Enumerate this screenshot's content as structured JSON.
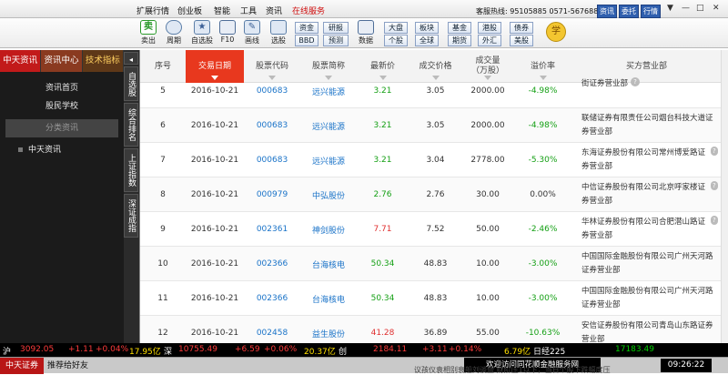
{
  "menubar": {
    "items": [
      "扩展行情",
      "创业板",
      "智能",
      "工具",
      "资讯",
      "在线服务"
    ],
    "hotline": "客服热线: 95105885  0571-56768888",
    "buttons": [
      "资讯",
      "委托",
      "行情"
    ],
    "controls": [
      "▼",
      "—",
      "□",
      "✕"
    ]
  },
  "toolbar": {
    "tools": [
      {
        "label": "卖出",
        "icon": "sell-icon",
        "color": "#2a9a2a"
      },
      {
        "label": "周期",
        "icon": "clock-icon",
        "color": "#5c7fa8"
      },
      {
        "label": "自选股",
        "icon": "star-icon",
        "color": "#5c7fa8"
      },
      {
        "label": "F10",
        "icon": "f10-icon",
        "color": "#4f6e98"
      },
      {
        "label": "画线",
        "icon": "pen-icon",
        "color": "#5c7fa8"
      },
      {
        "label": "选股",
        "icon": "filter-icon",
        "color": "#5c7fa8"
      },
      {
        "label": "数据",
        "icon": "pe-icon",
        "color": "#4f6e98"
      }
    ],
    "small_buttons": [
      "资金",
      "BBD",
      "研报",
      "预测",
      "大盘",
      "个股",
      "板块",
      "全球",
      "基金",
      "期货",
      "港股",
      "外汇",
      "债券",
      "美股"
    ],
    "learn_icon": "学"
  },
  "sidebar": {
    "tabs": [
      "中天资讯",
      "资讯中心",
      "技术指标"
    ],
    "links": [
      "资讯首页",
      "股民学校",
      "分类资讯"
    ],
    "tree": [
      "中天资讯"
    ],
    "vtabs": [
      "自选股",
      "综合排名",
      "上证指数",
      "深证成指"
    ]
  },
  "table": {
    "headers": [
      "序号",
      "交易日期",
      "股票代码",
      "股票简称",
      "最新价",
      "成交价格",
      "成交量\n（万股）",
      "溢价率",
      "买方营业部"
    ],
    "rows": [
      {
        "no": "5",
        "date": "2016-10-21",
        "code": "000683",
        "name": "远兴能源",
        "latest": "3.21",
        "latest_color": "green",
        "price": "3.05",
        "volume": "2000.00",
        "premium": "-4.98%",
        "premium_color": "green",
        "broker": "街证券营业部",
        "broker_help": true
      },
      {
        "no": "6",
        "date": "2016-10-21",
        "code": "000683",
        "name": "远兴能源",
        "latest": "3.21",
        "latest_color": "green",
        "price": "3.05",
        "volume": "2000.00",
        "premium": "-4.98%",
        "premium_color": "green",
        "broker": "联储证券有限责任公司烟台科技大道证券营业部",
        "broker_help": false
      },
      {
        "no": "7",
        "date": "2016-10-21",
        "code": "000683",
        "name": "远兴能源",
        "latest": "3.21",
        "latest_color": "green",
        "price": "3.04",
        "volume": "2778.00",
        "premium": "-5.30%",
        "premium_color": "green",
        "broker": "东海证券股份有限公司常州博爱路证券营业部",
        "broker_help": true
      },
      {
        "no": "8",
        "date": "2016-10-21",
        "code": "000979",
        "name": "中弘股份",
        "latest": "2.76",
        "latest_color": "green",
        "price": "2.76",
        "volume": "30.00",
        "premium": "0.00%",
        "premium_color": "plain",
        "broker": "中信证券股份有限公司北京呼家楼证券营业部",
        "broker_help": true
      },
      {
        "no": "9",
        "date": "2016-10-21",
        "code": "002361",
        "name": "神剑股份",
        "latest": "7.71",
        "latest_color": "red",
        "price": "7.52",
        "volume": "50.00",
        "premium": "-2.46%",
        "premium_color": "green",
        "broker": "华林证券股份有限公司合肥潜山路证券营业部",
        "broker_help": true
      },
      {
        "no": "10",
        "date": "2016-10-21",
        "code": "002366",
        "name": "台海核电",
        "latest": "50.34",
        "latest_color": "green",
        "price": "48.83",
        "volume": "10.00",
        "premium": "-3.00%",
        "premium_color": "green",
        "broker": "中国国际金融股份有限公司广州天河路证券营业部",
        "broker_help": false
      },
      {
        "no": "11",
        "date": "2016-10-21",
        "code": "002366",
        "name": "台海核电",
        "latest": "50.34",
        "latest_color": "green",
        "price": "48.83",
        "volume": "10.00",
        "premium": "-3.00%",
        "premium_color": "green",
        "broker": "中国国际金融股份有限公司广州天河路证券营业部",
        "broker_help": false
      },
      {
        "no": "12",
        "date": "2016-10-21",
        "code": "002458",
        "name": "益生股份",
        "latest": "41.28",
        "latest_color": "red",
        "price": "36.89",
        "volume": "55.00",
        "premium": "-10.63%",
        "premium_color": "green",
        "broker": "安信证券股份有限公司青岛山东路证券营业部",
        "broker_help": false
      }
    ]
  },
  "ticker": {
    "sh_label": "沪",
    "sh_value": "3092.05",
    "sh_change": "+1.11",
    "sh_pct": "+0.04%",
    "sh_amount": "17.95亿",
    "sz_label": "深",
    "sz_value": "10755.49",
    "sz_change": "+6.59",
    "sz_pct": "+0.06%",
    "sz_amount": "20.37亿",
    "cy_label": "创",
    "cy_value": "2184.11",
    "cy_change": "+3.11",
    "cy_pct": "+0.14%",
    "cy_amount": "6.79亿",
    "hs_label": "日经225",
    "hs_value": "17183.49"
  },
  "status": {
    "brand": "中天证券",
    "recommend": "推荐给好友",
    "welcome": "欢迎访问同花顺金融服务网",
    "time": "09:26:22",
    "behind_text": "议孩仪袁相别衰船刘谈暨  财阶压1以下，当日个股下跌幅度压"
  }
}
